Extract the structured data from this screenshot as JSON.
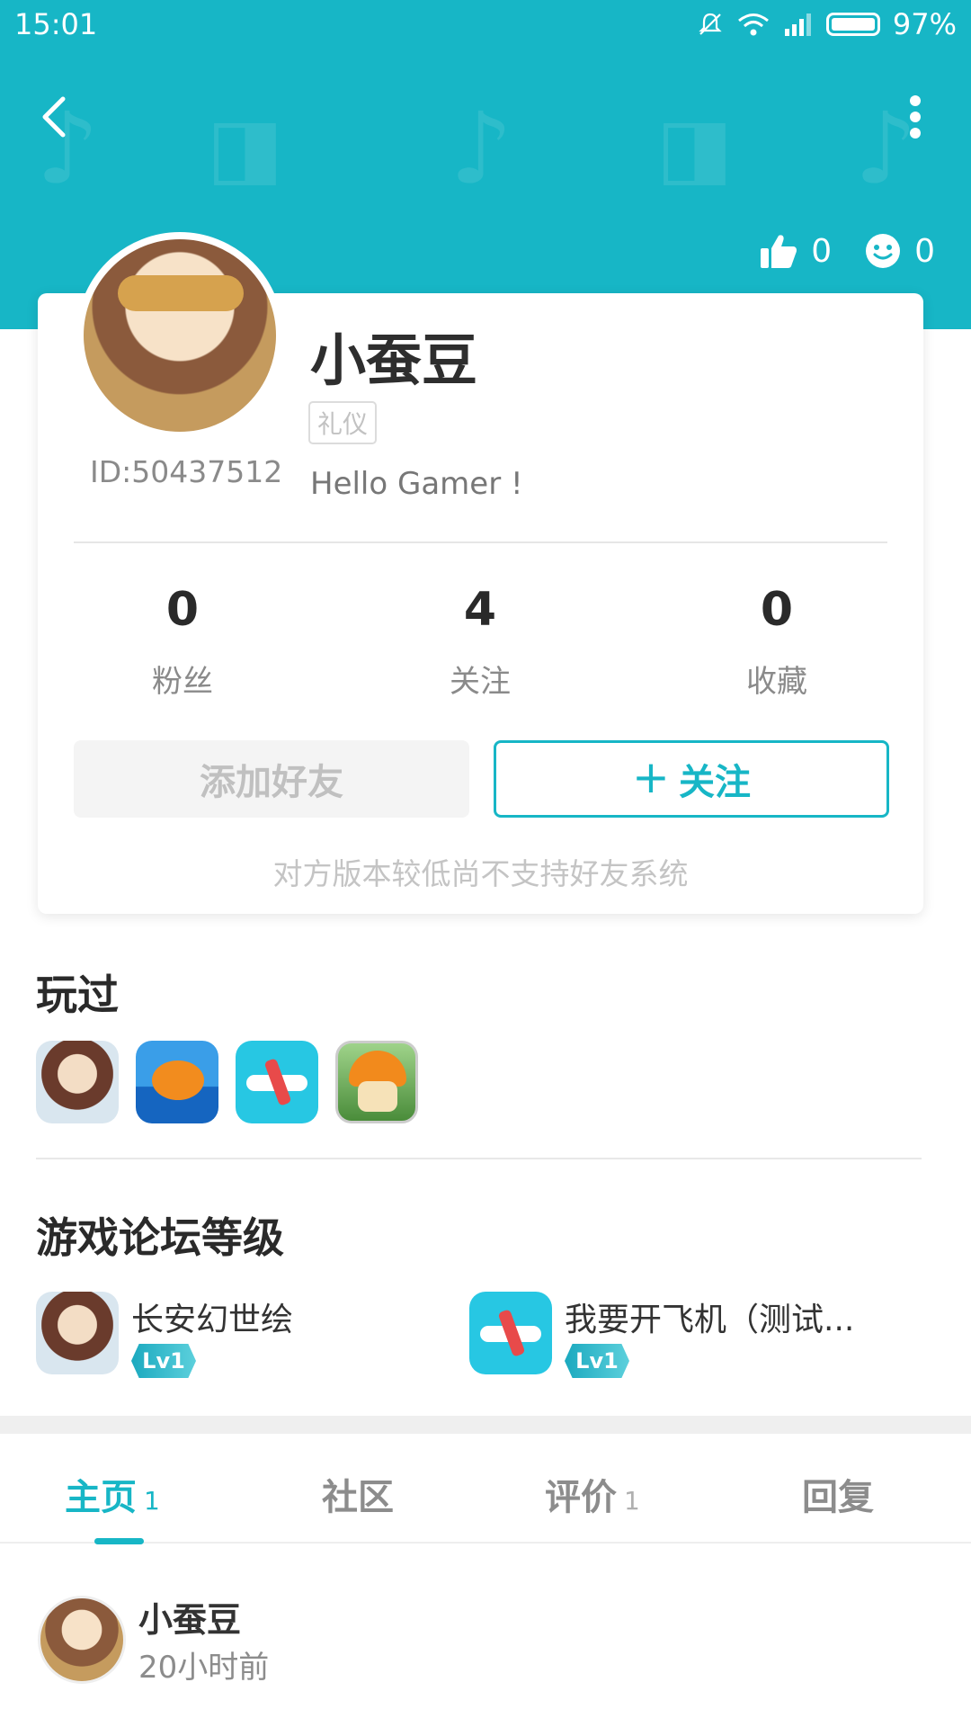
{
  "status_bar": {
    "time": "15:01",
    "battery": "97%"
  },
  "header": {
    "likes": "0",
    "smiles": "0"
  },
  "profile": {
    "id_text": "ID:50437512",
    "name": "小蚕豆",
    "tag": "礼仪",
    "bio": "Hello Gamer !",
    "stats": [
      {
        "value": "0",
        "label": "粉丝"
      },
      {
        "value": "4",
        "label": "关注"
      },
      {
        "value": "0",
        "label": "收藏"
      }
    ],
    "add_friend_label": "添加好友",
    "follow_plus": "+",
    "follow_label": "关注",
    "note": "对方版本较低尚不支持好友系统"
  },
  "played": {
    "title": "玩过"
  },
  "forum": {
    "title": "游戏论坛等级",
    "items": [
      {
        "name": "长安幻世绘",
        "level": "Lv1"
      },
      {
        "name": "我要开飞机（测试...",
        "level": "Lv1"
      }
    ]
  },
  "tabs": [
    {
      "label": "主页",
      "count": "1"
    },
    {
      "label": "社区",
      "count": ""
    },
    {
      "label": "评价",
      "count": "1"
    },
    {
      "label": "回复",
      "count": ""
    }
  ],
  "post": {
    "author": "小蚕豆",
    "time": "20小时前"
  },
  "colors": {
    "accent": "#17b6c6"
  }
}
